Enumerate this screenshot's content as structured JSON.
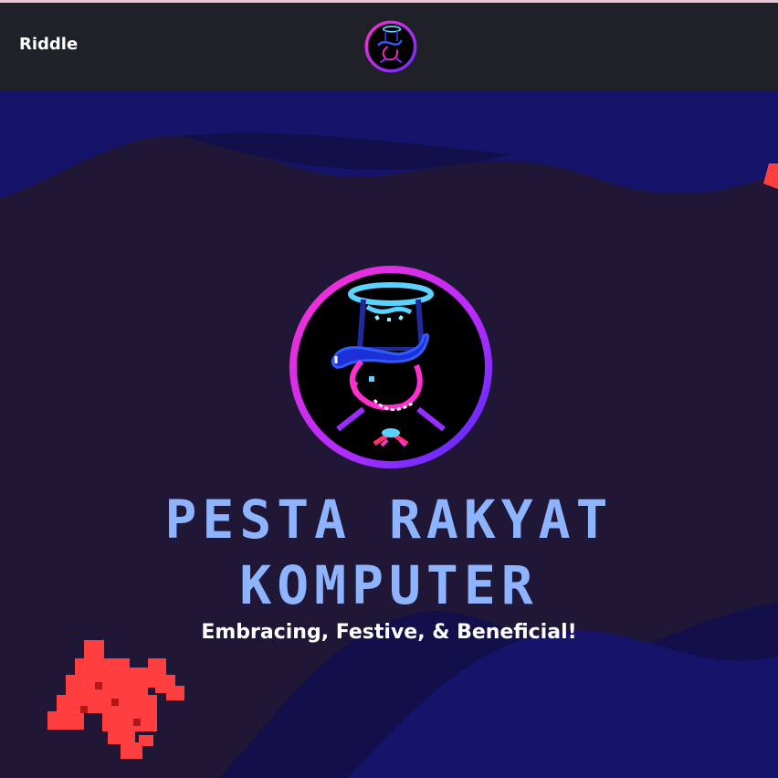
{
  "nav": {
    "link_label": "Riddle",
    "logo_icon": "pesta-rakyat-komputer-logo-icon"
  },
  "hero": {
    "logo_icon": "pesta-rakyat-komputer-logo-icon",
    "title_line1": "PESTA RAKYAT",
    "title_line2": "KOMPUTER",
    "subtitle": "Embracing, Festive, & Beneficial!",
    "decoration_icon": "pixel-invader-icon"
  },
  "colors": {
    "navbar_bg": "#202029",
    "page_bg": "#1f1735",
    "wave_bg": "#15136a",
    "title": "#8fb4ff",
    "accent_pink": "#ff2fd0",
    "accent_purple": "#7b2fff",
    "accent_cyan": "#5cd3ff",
    "invader": "#ff3f3f"
  }
}
